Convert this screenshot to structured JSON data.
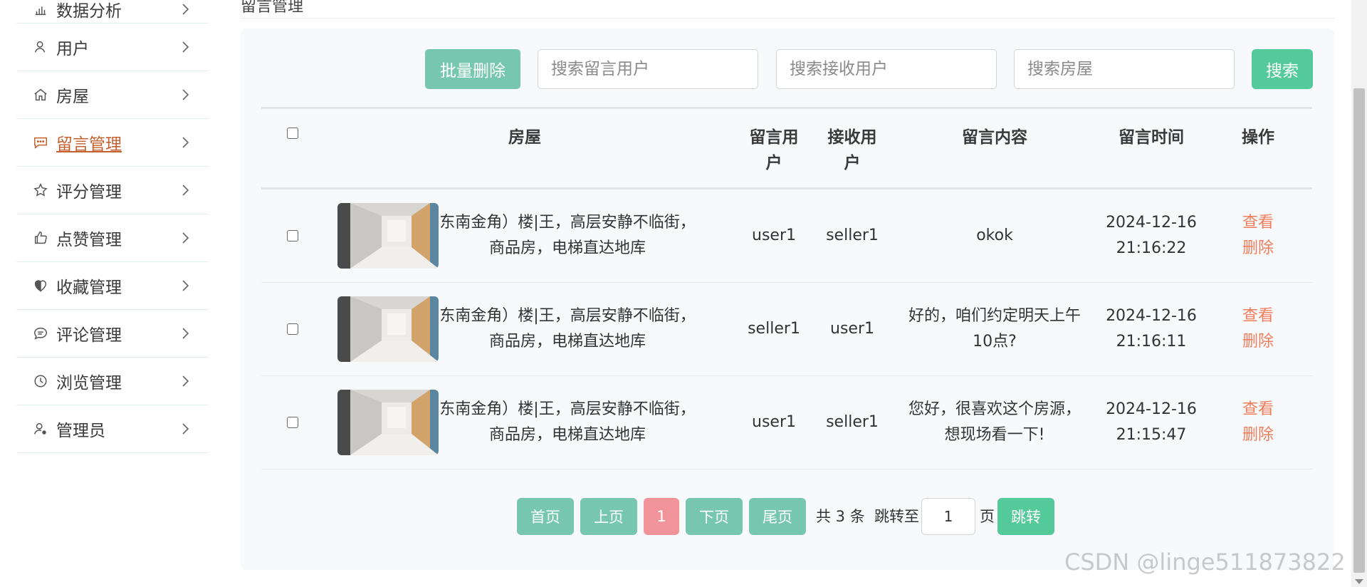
{
  "sidebar": {
    "items": [
      {
        "label": "数据分析",
        "icon": "bar-chart-icon"
      },
      {
        "label": "用户",
        "icon": "user-icon"
      },
      {
        "label": "房屋",
        "icon": "house-icon"
      },
      {
        "label": "留言管理",
        "icon": "chat-dots-icon",
        "active": true
      },
      {
        "label": "评分管理",
        "icon": "star-icon"
      },
      {
        "label": "点赞管理",
        "icon": "thumbs-up-icon"
      },
      {
        "label": "收藏管理",
        "icon": "heart-icon"
      },
      {
        "label": "评论管理",
        "icon": "comment-icon"
      },
      {
        "label": "浏览管理",
        "icon": "clock-icon"
      },
      {
        "label": "管理员",
        "icon": "user-gear-icon"
      }
    ]
  },
  "header": {
    "title": "留言管理"
  },
  "toolbar": {
    "batch_delete_label": "批量删除",
    "search_sender_placeholder": "搜索留言用户",
    "search_receiver_placeholder": "搜索接收用户",
    "search_house_placeholder": "搜索房屋",
    "search_label": "搜索"
  },
  "table": {
    "columns": {
      "house": "房屋",
      "sender": "留言用户",
      "receiver": "接收用户",
      "content": "留言内容",
      "time": "留言时间",
      "ops": "操作"
    },
    "rows": [
      {
        "house": "东南金角）楼|王，高层安静不临街，商品房，电梯直达地库",
        "sender": "user1",
        "receiver": "seller1",
        "content": "okok",
        "date": "2024-12-16",
        "time": "21:16:22",
        "view": "查看",
        "delete": "删除"
      },
      {
        "house": "东南金角）楼|王，高层安静不临街，商品房，电梯直达地库",
        "sender": "seller1",
        "receiver": "user1",
        "content": "好的，咱们约定明天上午10点?",
        "date": "2024-12-16",
        "time": "21:16:11",
        "view": "查看",
        "delete": "删除"
      },
      {
        "house": "东南金角）楼|王，高层安静不临街，商品房，电梯直达地库",
        "sender": "user1",
        "receiver": "seller1",
        "content": "您好，很喜欢这个房源，想现场看一下!",
        "date": "2024-12-16",
        "time": "21:15:47",
        "view": "查看",
        "delete": "删除"
      }
    ]
  },
  "pagination": {
    "first": "首页",
    "prev": "上页",
    "current": "1",
    "next": "下页",
    "last": "尾页",
    "total": "共 3 条",
    "jump_to": "跳转至",
    "page_input": "1",
    "page_unit": "页",
    "go": "跳转"
  },
  "watermark": "CSDN @linge511873822",
  "colors": {
    "active_menu": "#c4602f",
    "primary_green": "#54c99a",
    "muted_green": "#76c7ad",
    "current_page": "#f0949a",
    "op_link": "#ef7d5c"
  }
}
